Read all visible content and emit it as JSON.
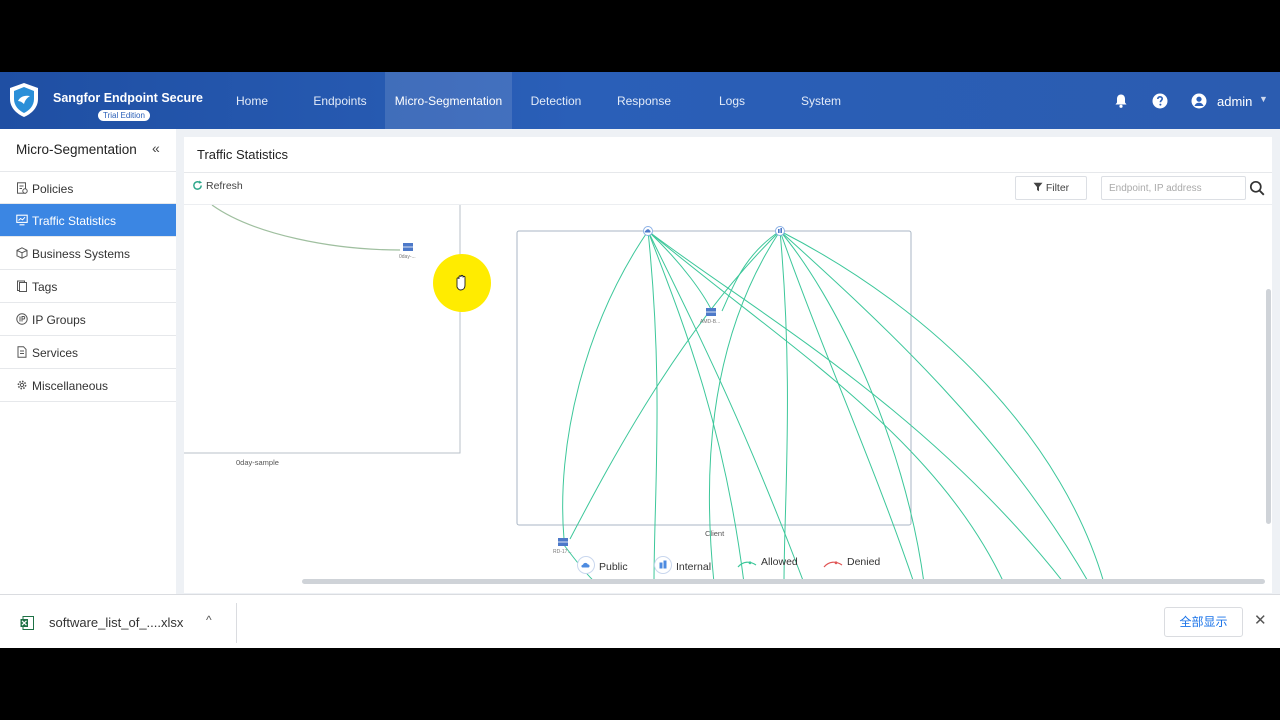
{
  "app": {
    "brand": "Sangfor Endpoint Secure",
    "edition": "Trial Edition",
    "accent": "#2a5fb8",
    "active_blue": "#3b86e3"
  },
  "nav": {
    "items": [
      {
        "label": "Home"
      },
      {
        "label": "Endpoints"
      },
      {
        "label": "Micro-Segmentation",
        "active": true
      },
      {
        "label": "Detection"
      },
      {
        "label": "Response"
      },
      {
        "label": "Logs"
      },
      {
        "label": "System"
      }
    ]
  },
  "header": {
    "user": "admin",
    "icons": [
      "bell-icon",
      "help-icon",
      "user-icon"
    ]
  },
  "sidebar": {
    "title": "Micro-Segmentation",
    "collapse": "«",
    "items": [
      {
        "label": "Policies",
        "icon": "policy-icon"
      },
      {
        "label": "Traffic Statistics",
        "icon": "monitor-icon",
        "active": true
      },
      {
        "label": "Business Systems",
        "icon": "cube-icon"
      },
      {
        "label": "Tags",
        "icon": "tag-icon"
      },
      {
        "label": "IP Groups",
        "icon": "ip-icon"
      },
      {
        "label": "Services",
        "icon": "document-icon"
      },
      {
        "label": "Miscellaneous",
        "icon": "gear-icon"
      }
    ]
  },
  "panel": {
    "title": "Traffic Statistics",
    "refresh_label": "Refresh",
    "filter_label": "Filter",
    "search_placeholder": "Endpoint, IP address"
  },
  "graph": {
    "groups": [
      {
        "label": "0day-sample"
      },
      {
        "label": "Client"
      }
    ],
    "nodes": [
      {
        "label": "0day-..."
      },
      {
        "label": "AMD-B..."
      },
      {
        "label": "RD-17..."
      }
    ],
    "edge_color_allowed": "#3cc79a",
    "edge_color_denied": "#e05555"
  },
  "legend": {
    "public": "Public",
    "internal": "Internal",
    "allowed": "Allowed",
    "denied": "Denied"
  },
  "download": {
    "file_name": "software_list_of_....xlsx",
    "show_all": "全部显示",
    "close": "✕",
    "caret": "^"
  }
}
